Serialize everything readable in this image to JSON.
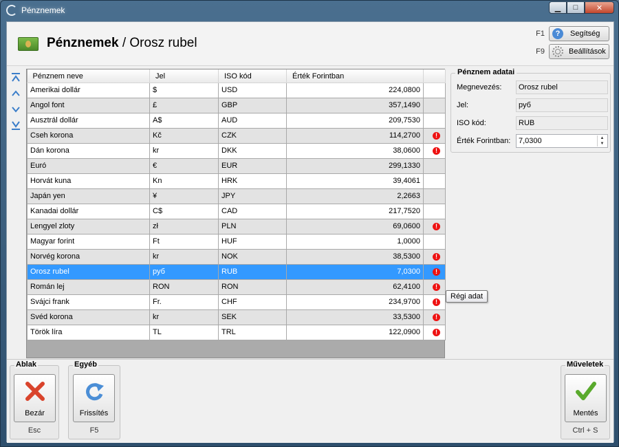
{
  "window": {
    "title": "Pénznemek",
    "minimize": "▁",
    "maximize": "□",
    "close": "✕"
  },
  "header": {
    "title_bold": "Pénznemek",
    "separator": "/",
    "title_sub": "Orosz rubel",
    "help": {
      "key": "F1",
      "label": "Segítség"
    },
    "settings": {
      "key": "F9",
      "label": "Beállítások"
    }
  },
  "grid": {
    "columns": [
      "Pénznem neve",
      "Jel",
      "ISO kód",
      "Érték Forintban",
      ""
    ],
    "rows": [
      {
        "name": "Amerikai dollár",
        "sign": "$",
        "iso": "USD",
        "value": "224,0800",
        "warn": false
      },
      {
        "name": "Angol font",
        "sign": "£",
        "iso": "GBP",
        "value": "357,1490",
        "warn": false
      },
      {
        "name": "Ausztrál dollár",
        "sign": "A$",
        "iso": "AUD",
        "value": "209,7530",
        "warn": false
      },
      {
        "name": "Cseh korona",
        "sign": "Kč",
        "iso": "CZK",
        "value": "114,2700",
        "warn": true
      },
      {
        "name": "Dán korona",
        "sign": "kr",
        "iso": "DKK",
        "value": "38,0600",
        "warn": true
      },
      {
        "name": "Euró",
        "sign": "€",
        "iso": "EUR",
        "value": "299,1330",
        "warn": false
      },
      {
        "name": "Horvát kuna",
        "sign": "Kn",
        "iso": "HRK",
        "value": "39,4061",
        "warn": false
      },
      {
        "name": "Japán yen",
        "sign": "¥",
        "iso": "JPY",
        "value": "2,2663",
        "warn": false
      },
      {
        "name": "Kanadai dollár",
        "sign": "C$",
        "iso": "CAD",
        "value": "217,7520",
        "warn": false
      },
      {
        "name": "Lengyel zloty",
        "sign": "zł",
        "iso": "PLN",
        "value": "69,0600",
        "warn": true
      },
      {
        "name": "Magyar forint",
        "sign": "Ft",
        "iso": "HUF",
        "value": "1,0000",
        "warn": false
      },
      {
        "name": "Norvég korona",
        "sign": "kr",
        "iso": "NOK",
        "value": "38,5300",
        "warn": true
      },
      {
        "name": "Orosz rubel",
        "sign": "руб",
        "iso": "RUB",
        "value": "7,0300",
        "warn": true,
        "selected": true
      },
      {
        "name": "Román lej",
        "sign": "RON",
        "iso": "RON",
        "value": "62,4100",
        "warn": true
      },
      {
        "name": "Svájci frank",
        "sign": "Fr.",
        "iso": "CHF",
        "value": "234,9700",
        "warn": true
      },
      {
        "name": "Svéd korona",
        "sign": "kr",
        "iso": "SEK",
        "value": "33,5300",
        "warn": true
      },
      {
        "name": "Török líra",
        "sign": "TL",
        "iso": "TRL",
        "value": "122,0900",
        "warn": true
      }
    ],
    "warn_glyph": "!",
    "tooltip": "Régi adat"
  },
  "details": {
    "title": "Pénznem adatai",
    "name_label": "Megnevezés:",
    "name_value": "Orosz rubel",
    "sign_label": "Jel:",
    "sign_value": "руб",
    "iso_label": "ISO kód:",
    "iso_value": "RUB",
    "value_label": "Érték Forintban:",
    "value_value": "7,0300"
  },
  "bottom": {
    "window_group": "Ablak",
    "close_label": "Bezár",
    "close_shortcut": "Esc",
    "other_group": "Egyéb",
    "refresh_label": "Frissítés",
    "refresh_shortcut": "F5",
    "ops_group": "Műveletek",
    "save_label": "Mentés",
    "save_shortcut": "Ctrl + S"
  }
}
